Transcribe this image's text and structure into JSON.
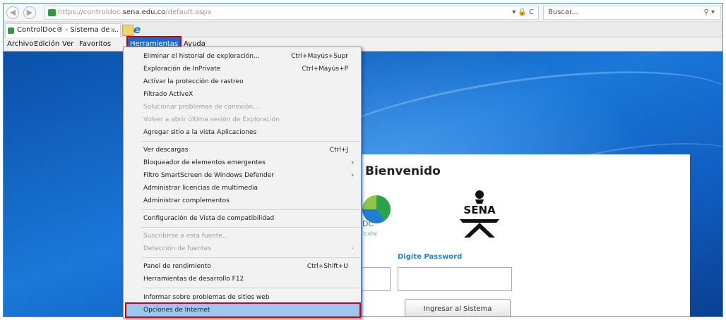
{
  "browser": {
    "url_prefix": "https://controldoc.",
    "url_domain": "sena.edu.co",
    "url_suffix": "/default.aspx",
    "url_tools": "▾ 🔒 C",
    "search_placeholder": "Buscar...",
    "search_glyph": "⚲ ▾",
    "tab_title": "ControlDoc® - Sistema de ...",
    "tab_close": "×",
    "logo_glyph": "e"
  },
  "menubar": {
    "items": [
      "Archivo",
      "Edición",
      "Ver",
      "Favoritos",
      "Herramientas",
      "Ayuda"
    ],
    "active": "Herramientas"
  },
  "tools_menu": {
    "items": [
      {
        "label": "Eliminar el historial de exploración...",
        "shortcut": "Ctrl+Mayús+Supr",
        "disabled": false,
        "submenu": false
      },
      {
        "label": "Exploración de InPrivate",
        "shortcut": "Ctrl+Mayús+P",
        "disabled": false,
        "submenu": false
      },
      {
        "label": "Activar la protección de rastreo",
        "shortcut": "",
        "disabled": false,
        "submenu": false
      },
      {
        "label": "Filtrado ActiveX",
        "shortcut": "",
        "disabled": false,
        "submenu": false
      },
      {
        "label": "Solucionar problemas de conexión...",
        "shortcut": "",
        "disabled": true,
        "submenu": false
      },
      {
        "label": "Volver a abrir última sesión de Exploración",
        "shortcut": "",
        "disabled": true,
        "submenu": false
      },
      {
        "label": "Agregar sitio a la vista Aplicaciones",
        "shortcut": "",
        "disabled": false,
        "submenu": false
      },
      {
        "label": "Ver descargas",
        "shortcut": "Ctrl+J",
        "disabled": false,
        "submenu": false
      },
      {
        "label": "Bloqueador de elementos emergentes",
        "shortcut": "",
        "disabled": false,
        "submenu": true
      },
      {
        "label": "Filtro SmartScreen de Windows Defender",
        "shortcut": "",
        "disabled": false,
        "submenu": true
      },
      {
        "label": "Administrar licencias de multimedia",
        "shortcut": "",
        "disabled": false,
        "submenu": false
      },
      {
        "label": "Administrar complementos",
        "shortcut": "",
        "disabled": false,
        "submenu": false
      },
      {
        "label": "Configuración de Vista de compatibilidad",
        "shortcut": "",
        "disabled": false,
        "submenu": false
      },
      {
        "label": "Suscribirse a esta fuente...",
        "shortcut": "",
        "disabled": true,
        "submenu": false
      },
      {
        "label": "Detección de fuentes",
        "shortcut": "",
        "disabled": true,
        "submenu": true
      },
      {
        "label": "Panel de rendimiento",
        "shortcut": "Ctrl+Shift+U",
        "disabled": false,
        "submenu": false
      },
      {
        "label": "Herramientas de desarrollo F12",
        "shortcut": "",
        "disabled": false,
        "submenu": false
      },
      {
        "label": "Informar sobre problemas de sitios web",
        "shortcut": "",
        "disabled": false,
        "submenu": false
      },
      {
        "label": "Opciones de Internet",
        "shortcut": "",
        "disabled": false,
        "submenu": false
      }
    ],
    "arrow_glyph": "›",
    "highlighted": "Opciones de Internet"
  },
  "login": {
    "welcome": "Bienvenido",
    "logo_partial_text": "DC",
    "logo_partial_sub": "CIÓN",
    "sena_text": "SENA",
    "password_label": "Digite Password",
    "submit_label": "Ingresar al Sistema"
  },
  "colors": {
    "accent": "#1b6ac9",
    "highlight_box": "#d0021b",
    "menu_hover": "#9ec7f0",
    "sena_green": "#111111"
  }
}
